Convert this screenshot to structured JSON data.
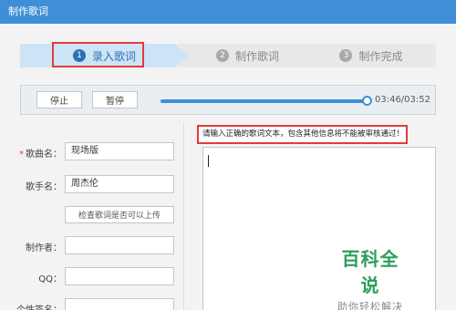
{
  "window": {
    "title": "制作歌词"
  },
  "steps": [
    {
      "num": "1",
      "label": "录入歌词"
    },
    {
      "num": "2",
      "label": "制作歌词"
    },
    {
      "num": "3",
      "label": "制作完成"
    }
  ],
  "player": {
    "stop_label": "停止",
    "pause_label": "暂停",
    "progress": 0.987,
    "time": "03:46/03:52"
  },
  "form": {
    "song_label": "歌曲名：",
    "song_value": "现场版",
    "singer_label": "歌手名：",
    "singer_value": "周杰伦",
    "check_label": "检查歌词是否可以上传",
    "maker_label": "制作者：",
    "maker_value": "",
    "qq_label": "QQ：",
    "qq_value": "",
    "sign_label": "个性签名：",
    "sign_value": ""
  },
  "hint": "请输入正确的歌词文本，包含其他信息将不能被审核通过！",
  "lyrics": {
    "value": ""
  },
  "watermark": {
    "title": "百科全说",
    "subtitle": "助你轻松解决"
  },
  "colors": {
    "accent": "#3e8fd6",
    "highlight": "#e23b3b",
    "watermark": "#2c9e5c"
  }
}
